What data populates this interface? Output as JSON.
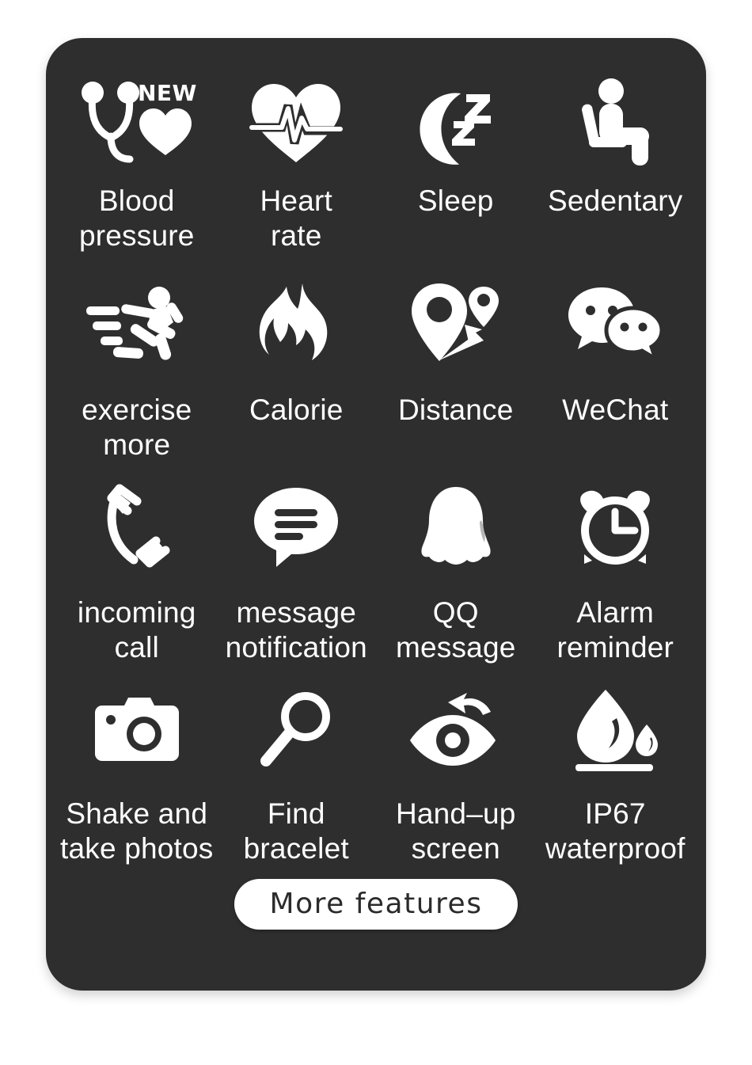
{
  "card": {
    "background_color": "#2e2e2e",
    "text_color": "#ffffff",
    "page_background": "#ffffff"
  },
  "badges": {
    "new": "NEW"
  },
  "features": [
    {
      "icon": "blood-pressure-stethoscope-heart-icon",
      "label": "Blood\npressure",
      "badge": "NEW"
    },
    {
      "icon": "heart-rate-pulse-icon",
      "label": "Heart\nrate",
      "badge": ""
    },
    {
      "icon": "sleep-moon-zzz-icon",
      "label": "Sleep",
      "badge": ""
    },
    {
      "icon": "sedentary-sitting-person-icon",
      "label": "Sedentary",
      "badge": ""
    },
    {
      "icon": "exercise-running-person-icon",
      "label": "exercise\nmore",
      "badge": ""
    },
    {
      "icon": "calorie-flame-icon",
      "label": "Calorie",
      "badge": ""
    },
    {
      "icon": "distance-map-pin-route-icon",
      "label": "Distance",
      "badge": ""
    },
    {
      "icon": "wechat-bubbles-icon",
      "label": "WeChat",
      "badge": ""
    },
    {
      "icon": "incoming-call-handset-icon",
      "label": "incoming\ncall",
      "badge": ""
    },
    {
      "icon": "message-notification-bubble-icon",
      "label": "message\nnotification",
      "badge": ""
    },
    {
      "icon": "qq-penguin-icon",
      "label": "QQ\nmessage",
      "badge": ""
    },
    {
      "icon": "alarm-clock-icon",
      "label": "Alarm\nreminder",
      "badge": ""
    },
    {
      "icon": "camera-shutter-icon",
      "label": "Shake and\ntake photos",
      "badge": ""
    },
    {
      "icon": "magnifier-search-icon",
      "label": "Find\nbracelet",
      "badge": ""
    },
    {
      "icon": "eye-raise-arrow-icon",
      "label": "Hand–up\nscreen",
      "badge": ""
    },
    {
      "icon": "waterproof-droplet-icon",
      "label": "IP67\nwaterproof",
      "badge": ""
    }
  ],
  "more_features": {
    "label": "More features"
  }
}
